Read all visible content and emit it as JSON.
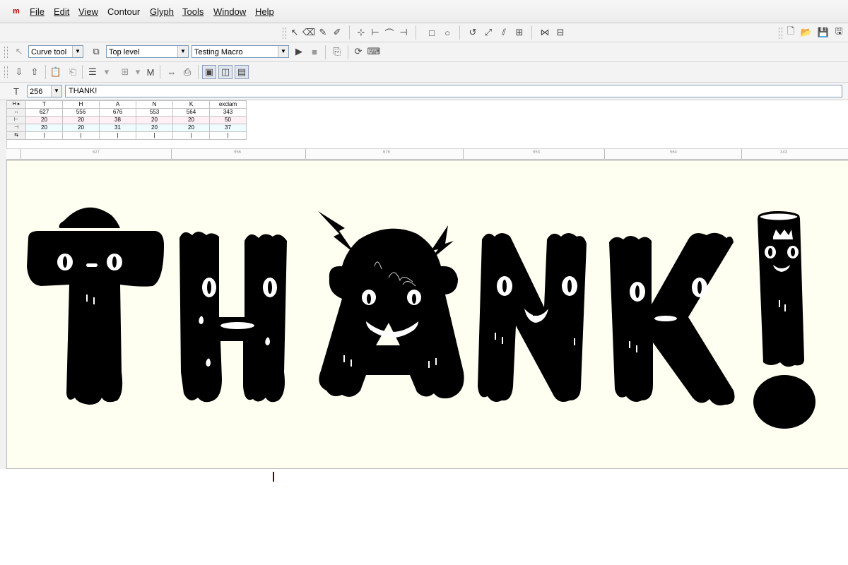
{
  "app": {
    "logo": "m"
  },
  "menu": [
    "File",
    "Edit",
    "View",
    "Contour",
    "Glyph",
    "Tools",
    "Window",
    "Help"
  ],
  "toolbar": {
    "tool": "Curve tool",
    "level": "Top level",
    "macro": "Testing Macro",
    "size": "256",
    "text": "THANK!"
  },
  "metrics": {
    "glyphs": [
      "T",
      "H",
      "A",
      "N",
      "K",
      "exclam"
    ],
    "width": [
      "627",
      "556",
      "676",
      "553",
      "564",
      "343"
    ],
    "lsb": [
      "20",
      "20",
      "38",
      "20",
      "20",
      "50"
    ],
    "rsb": [
      "20",
      "20",
      "31",
      "20",
      "20",
      "37"
    ]
  },
  "ruler": [
    "627",
    "556",
    "676",
    "553",
    "564",
    "343"
  ],
  "colors": {
    "canvas": "#fefff1",
    "glyph": "#000000"
  }
}
